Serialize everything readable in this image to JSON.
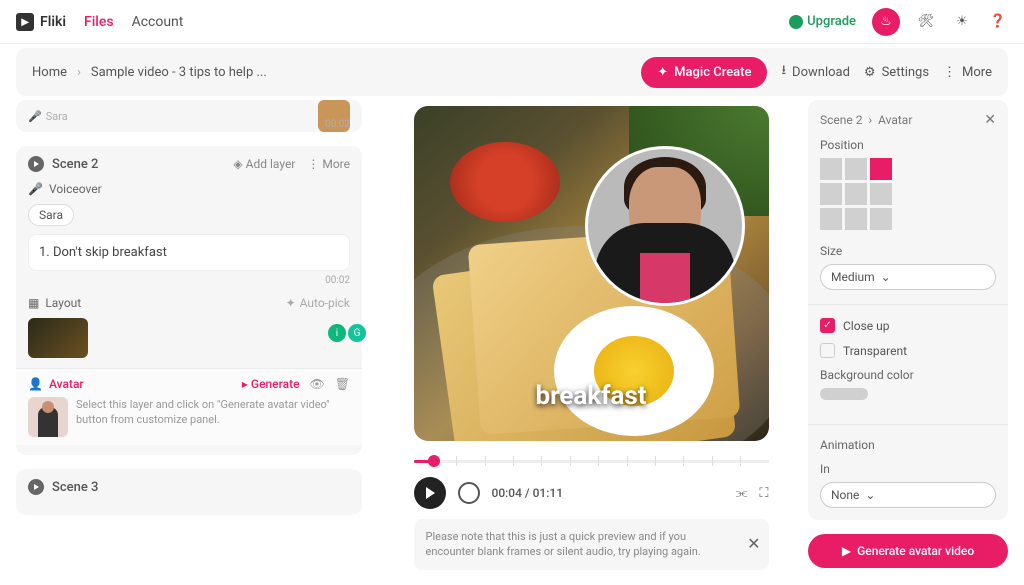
{
  "brand": "Fliki",
  "nav": {
    "files": "Files",
    "account": "Account",
    "upgrade": "Upgrade"
  },
  "subbar": {
    "home": "Home",
    "file": "Sample video - 3 tips to help ...",
    "magic": "Magic Create",
    "download": "Download",
    "settings": "Settings",
    "more": "More"
  },
  "scene1": {
    "voice": "Sara",
    "time": "00:02"
  },
  "scene2": {
    "title": "Scene 2",
    "addLayer": "Add layer",
    "more": "More",
    "voiceover": "Voiceover",
    "voice": "Sara",
    "text": "1. Don't skip breakfast",
    "time": "00:02",
    "layout": "Layout",
    "autopick": "Auto-pick",
    "avatar": "Avatar",
    "generate": "Generate",
    "hint": "Select this layer and click on \"Generate avatar video\" button from customize panel."
  },
  "scene3": {
    "title": "Scene 3"
  },
  "preview": {
    "caption": "breakfast"
  },
  "player": {
    "time": "00:04 / 01:11"
  },
  "notice": "Please note that this is just a quick preview and if you encounter blank frames or silent audio, try playing again.",
  "panel": {
    "crumb1": "Scene 2",
    "crumb2": "Avatar",
    "position": "Position",
    "size": "Size",
    "sizeVal": "Medium",
    "closeup": "Close up",
    "transparent": "Transparent",
    "bgcolor": "Background color",
    "animation": "Animation",
    "in": "In",
    "inVal": "None",
    "generate": "Generate avatar video"
  }
}
